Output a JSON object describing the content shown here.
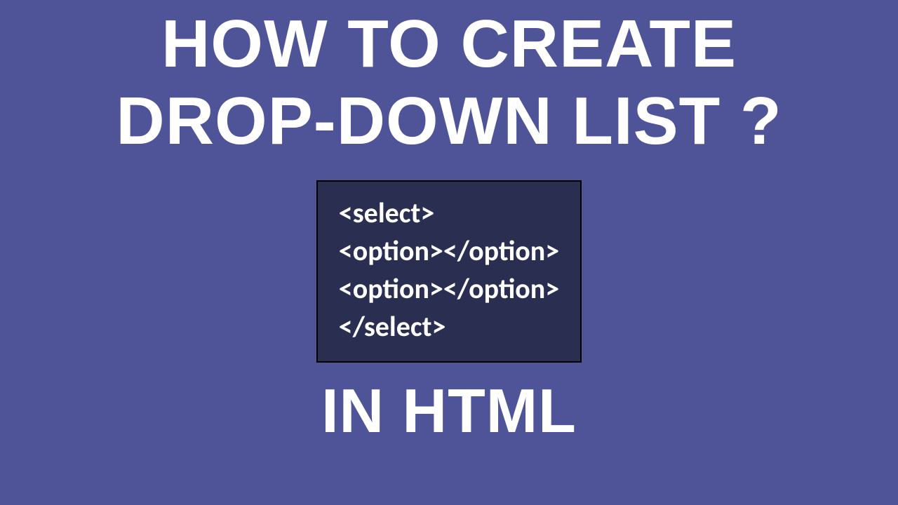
{
  "title": {
    "line1": "HOW TO CREATE",
    "line2": "DROP-DOWN LIST ?"
  },
  "code": {
    "line1": "<select>",
    "line2": "<option></option>",
    "line3": "<option></option>",
    "line4": "</select>"
  },
  "footer": "IN HTML"
}
